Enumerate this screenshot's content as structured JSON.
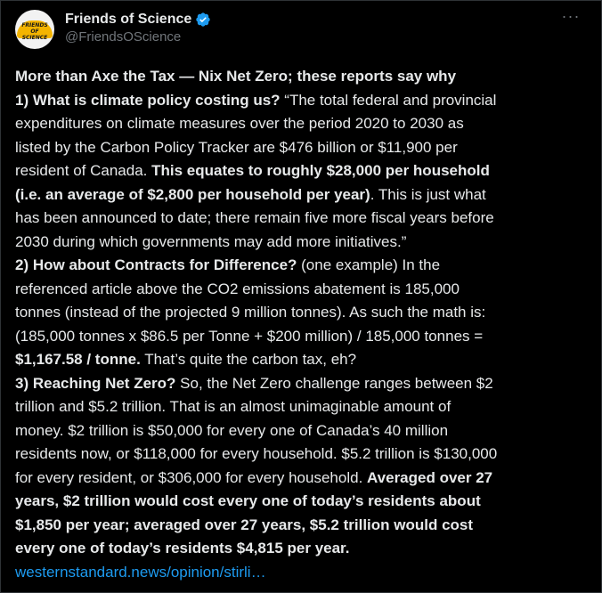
{
  "author": {
    "display_name": "Friends of Science",
    "handle": "@FriendsOScience",
    "avatar_text": "FRIENDS OF SCIENCE"
  },
  "icons": {
    "verified": "verified-badge-icon",
    "more": "more-options-icon"
  },
  "colors": {
    "background": "#000000",
    "text": "#e7e9ea",
    "secondary": "#71767b",
    "link": "#1d9bf0",
    "verified": "#1d9bf0"
  },
  "tweet": {
    "title": "More than Axe the Tax — Nix Net Zero; these reports say why",
    "p1_head": "1) What is climate policy costing us?",
    "p1_a": " “The total federal and provincial",
    "p1_b": "expenditures on climate measures over the period 2020 to 2030 as",
    "p1_c": "listed by the Carbon Policy Tracker are $476 billion or $11,900 per",
    "p1_d": "resident of Canada. ",
    "p1_d_bold": "This equates to roughly $28,000 per household",
    "p1_e_bold": "(i.e. an average of $2,800 per household per year)",
    "p1_e": ". This is just what",
    "p1_f": "has been announced to date; there remain five more fiscal years before",
    "p1_g": "2030 during which governments may add more initiatives.”",
    "p2_head": "2) How about Contracts for Difference?",
    "p2_a": " (one example) In the",
    "p2_b": "referenced article above the CO2 emissions abatement is 185,000",
    "p2_c": "tonnes (instead of the projected 9 million tonnes). As such the math is:",
    "p2_d": "(185,000 tonnes x $86.5 per Tonne + $200 million) / 185,000 tonnes =",
    "p2_e_bold": "$1,167.58 / tonne.",
    "p2_e": "  That’s quite the carbon tax, eh?",
    "p3_head": "3) Reaching Net Zero?",
    "p3_a": "  So, the Net Zero challenge ranges between $2",
    "p3_b": "trillion and $5.2 trillion. That is an almost unimaginable amount of",
    "p3_c": "money. $2 trillion is $50,000 for every one of Canada’s 40 million",
    "p3_d": "residents now, or $118,000 for every household. $5.2 trillion is $130,000",
    "p3_e": "for every resident, or $306,000 for every household. ",
    "p3_e_bold": "Averaged over 27",
    "p3_f_bold": "years, $2 trillion would cost every one of today’s residents about",
    "p3_g_bold": "$1,850 per year; averaged over 27 years, $5.2 trillion would cost",
    "p3_h_bold": "every one of today’s residents $4,815 per year.",
    "link": "westernstandard.news/opinion/stirli…"
  }
}
